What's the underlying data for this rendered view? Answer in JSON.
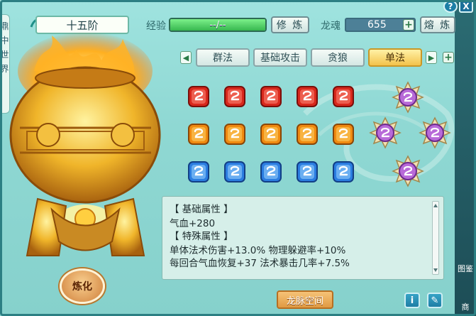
{
  "left_tab": {
    "chars": [
      "鼎",
      "中",
      "世",
      "界"
    ]
  },
  "rank": {
    "label": "十五阶"
  },
  "exp": {
    "label": "经验",
    "value": "--/--",
    "fill": 1.0
  },
  "cultivate_btn": {
    "label": "修 炼"
  },
  "dragon_soul": {
    "label": "龙魂",
    "value": "655"
  },
  "smelt_btn": {
    "label": "熔 炼"
  },
  "tabs": [
    {
      "label": "群法"
    },
    {
      "label": "基础攻击"
    },
    {
      "label": "贪狼"
    },
    {
      "label": "单法"
    }
  ],
  "active_tab": "单法",
  "gem_rows": [
    {
      "color": "red",
      "count": 5
    },
    {
      "color": "orange",
      "count": 5
    },
    {
      "color": "blue",
      "count": 5
    }
  ],
  "stats": {
    "section1": "【 基础属性 】",
    "line1": "气血+280",
    "section2": "【 特殊属性 】",
    "line2": "单体法术伤害+13.0%  物理躲避率+10%",
    "line3": "每回合气血恢复+37  法术暴击几率+7.5%"
  },
  "refine_btn": {
    "label": "炼化"
  },
  "space_btn": {
    "label": "龙脉空间"
  },
  "info_btn": {
    "label": "i"
  },
  "side_icons": [
    {
      "label": "图鉴"
    },
    {
      "label": "商"
    }
  ],
  "top_icons": {
    "help": "?",
    "close": "X"
  },
  "colors": {
    "accent": "#f3c34c",
    "panel": "#8fd8d3",
    "exp_fill": "#37b74f"
  }
}
